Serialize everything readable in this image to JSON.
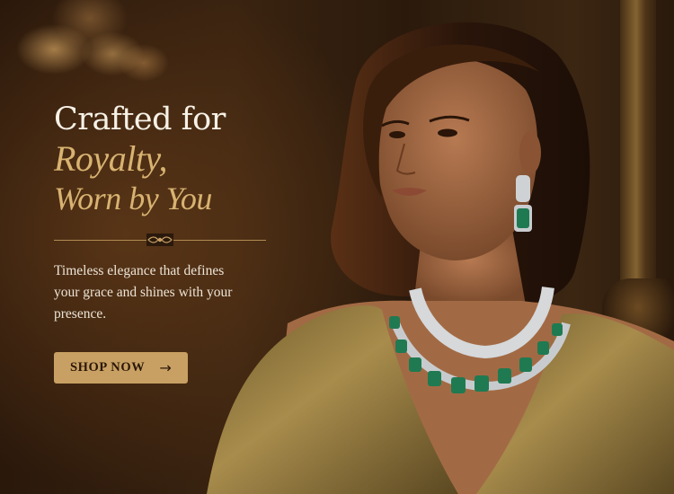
{
  "hero": {
    "headline_line1": "Crafted for",
    "headline_line2": "Royalty,",
    "headline_line3": "Worn by You",
    "subtext": "Timeless elegance that defines your grace and shines with your presence.",
    "cta_label": "SHOP NOW"
  },
  "icons": {
    "cta_arrow": "arrow-right-icon",
    "divider_ornament": "ornament-icon"
  },
  "colors": {
    "accent_gold": "#c8a063",
    "headline_gold": "#d8b371",
    "headline_light": "#f7f1e6",
    "emerald": "#1f7a52",
    "dress": "#8b7336"
  }
}
